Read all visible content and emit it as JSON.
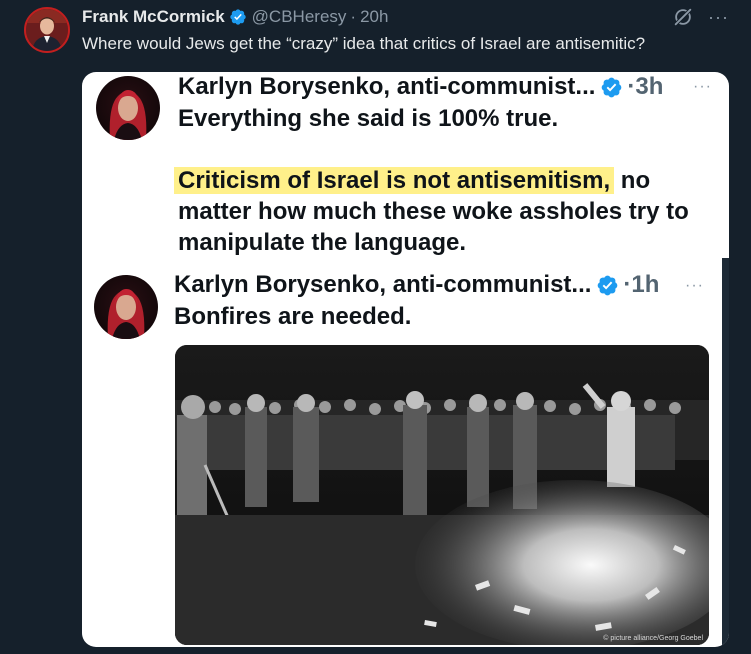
{
  "tweet": {
    "author_name": "Frank McCormick",
    "handle": "@CBHeresy",
    "separator": "·",
    "time": "20h",
    "text": "Where would Jews get the “crazy” idea that critics of Israel are antisemitic?",
    "icons": {
      "verified": "verified-badge-icon",
      "grok": "grok-icon",
      "more": "more-icon"
    },
    "more_glyph": "···"
  },
  "screenshot": {
    "quote1": {
      "author": "Karlyn Borysenko, anti-communist...",
      "separator": "·",
      "time": "3h",
      "line1": "Everything she said is 100% true.",
      "highlight": "Criticism of Israel is not antisemitism,",
      "after_highlight": " no",
      "line3": "matter how much these woke assholes try to",
      "line4": "manipulate the language."
    },
    "quote2": {
      "author": "Karlyn Borysenko, anti-communist...",
      "separator": "·",
      "time": "1h",
      "text": "Bonfires are needed."
    },
    "photo_credit": "© picture alliance/Georg Goebel",
    "more_glyph": "···"
  },
  "colors": {
    "background": "#15202b",
    "verified_blue": "#1d9bf0",
    "highlight_yellow": "#fff08a",
    "text_primary": "#e7e9ea",
    "text_secondary": "#8b98a5"
  }
}
